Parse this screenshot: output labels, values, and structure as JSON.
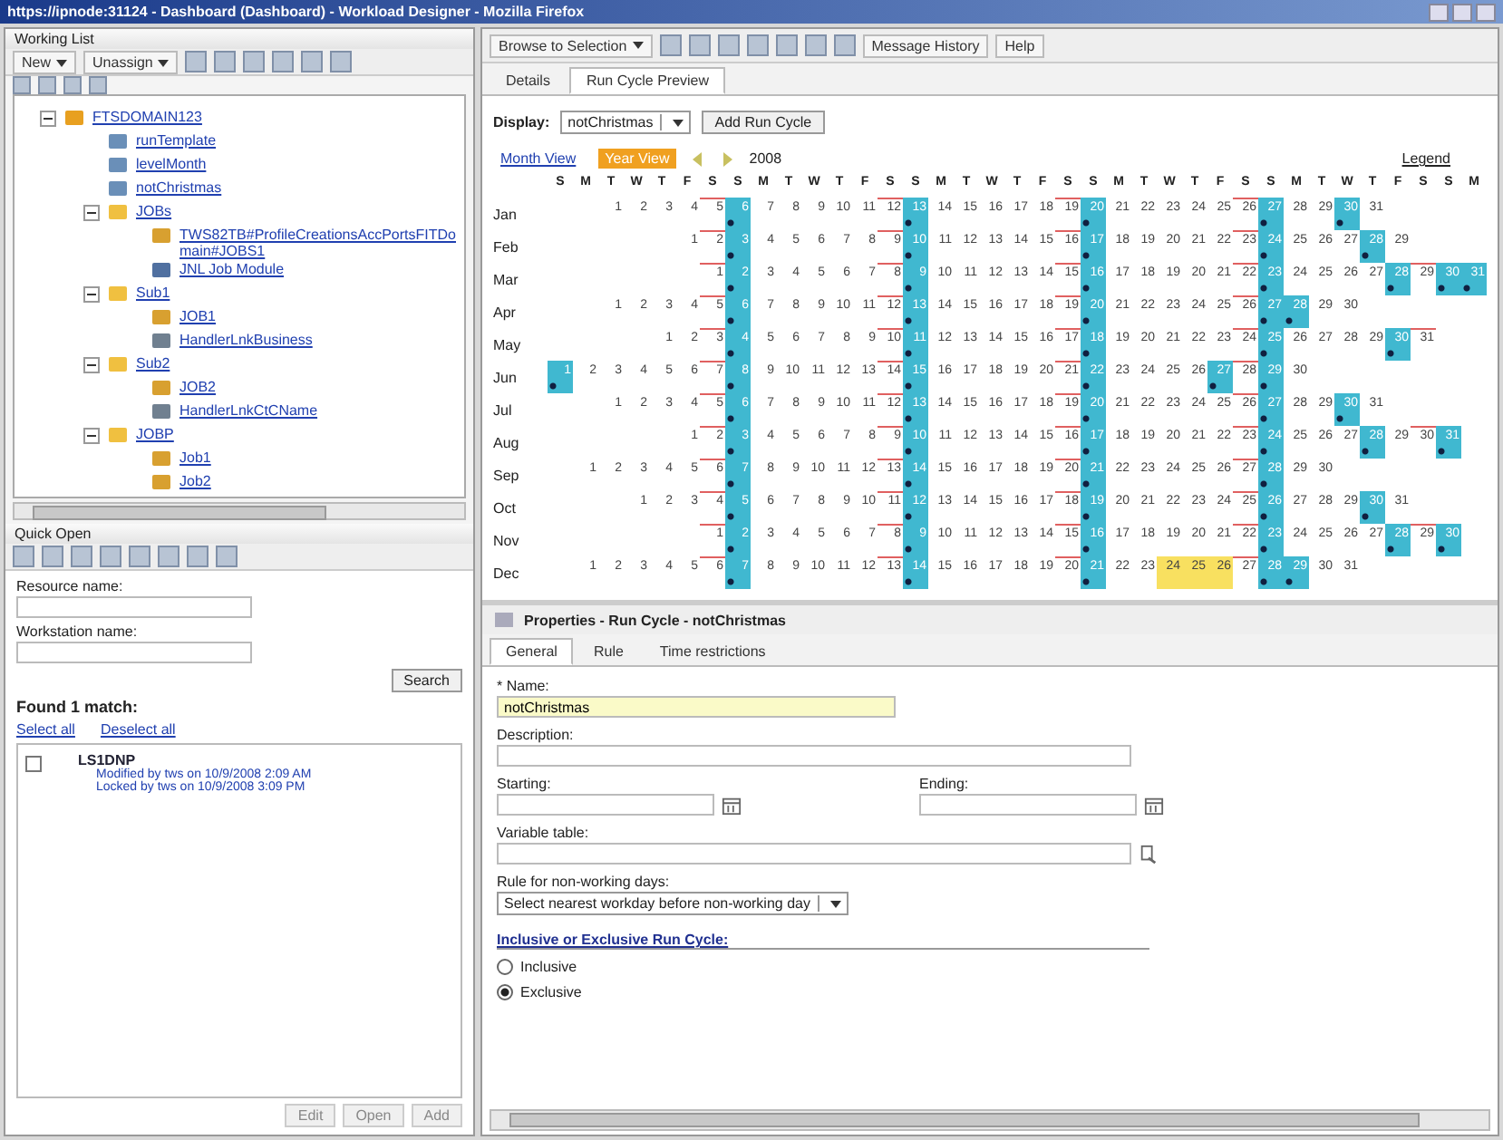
{
  "window": {
    "title": "https://ipnode:31124 - Dashboard (Dashboard) - Workload Designer - Mozilla Firefox"
  },
  "working_list": {
    "title": "Working List",
    "buttons": [
      "New",
      "Unassign"
    ],
    "tree": [
      {
        "label": "FTSDOMAIN123",
        "kind": "domain",
        "expanded": true,
        "children": [
          {
            "label": "runTemplate",
            "kind": "runcycle"
          },
          {
            "label": "levelMonth",
            "kind": "runcycle"
          },
          {
            "label": "notChristmas",
            "kind": "runcycle"
          },
          {
            "label": "JOBs",
            "kind": "folder",
            "expanded": true,
            "children": [
              {
                "label": "TWS82TB#ProfileCreationsAccPortsFITDomain#JOBS1",
                "kind": "job"
              },
              {
                "label": "JNL Job Module",
                "kind": "jobdef"
              }
            ]
          },
          {
            "label": "Sub1",
            "kind": "folder",
            "expanded": true,
            "children": [
              {
                "label": "JOB1",
                "kind": "job"
              },
              {
                "label": "HandlerLnkBusiness",
                "kind": "stream"
              }
            ]
          },
          {
            "label": "Sub2",
            "kind": "folder",
            "expanded": true,
            "children": [
              {
                "label": "JOB2",
                "kind": "job"
              },
              {
                "label": "HandlerLnkCtCName",
                "kind": "stream"
              }
            ]
          },
          {
            "label": "JOBP",
            "kind": "folder",
            "expanded": true,
            "children": [
              {
                "label": "Job1",
                "kind": "job"
              },
              {
                "label": "Job2",
                "kind": "job"
              }
            ]
          }
        ]
      }
    ]
  },
  "quick_open": {
    "title": "Quick Open",
    "fields": [
      {
        "label": "Resource name:"
      },
      {
        "label": "Workstation name:"
      }
    ],
    "search_button": "Search",
    "result_count": "Found 1 match:",
    "links": [
      "Select all",
      "Deselect all"
    ],
    "results": [
      {
        "name": "LS1DNP",
        "checked": false,
        "lines": [
          "Modified by tws on 10/9/2008 2:09 AM",
          "Locked by tws on 10/9/2008 3:09 PM"
        ]
      }
    ],
    "buttons": [
      "Edit",
      "Open",
      "Add"
    ]
  },
  "toolbar": {
    "browse": "Browse to Selection",
    "buttons": [
      "Message History",
      "Help"
    ]
  },
  "tabs": [
    {
      "label": "Details",
      "selected": false
    },
    {
      "label": "Run Cycle Preview",
      "selected": true
    }
  ],
  "display": {
    "label": "Display:",
    "value": "notChristmas",
    "add_button": "Add Run Cycle"
  },
  "views": [
    {
      "label": "Month View",
      "selected": false
    },
    {
      "label": "Year View",
      "selected": true
    }
  ],
  "year": "2008",
  "legend": "Legend",
  "calendar": {
    "weekdays": [
      "S",
      "M",
      "T",
      "W",
      "T",
      "F",
      "S",
      "S",
      "M",
      "T",
      "W",
      "T",
      "F",
      "S",
      "S",
      "M",
      "T",
      "W",
      "T",
      "F",
      "S",
      "S",
      "M",
      "T",
      "W",
      "T",
      "F",
      "S",
      "S",
      "M",
      "T",
      "W",
      "T",
      "F",
      "S",
      "S",
      "M"
    ],
    "months": [
      {
        "name": "Jan",
        "days": [
          {
            "day": "1",
            "run": false
          },
          {
            "day": "2",
            "run": false
          },
          {
            "day": "3",
            "run": false
          },
          {
            "day": "4",
            "run": false
          },
          {
            "day": "5",
            "run": false
          },
          {
            "day": "6",
            "run": true
          },
          {
            "day": "7",
            "run": false
          },
          {
            "day": "8",
            "run": false
          },
          {
            "day": "9",
            "run": false
          },
          {
            "day": "10",
            "run": false
          },
          {
            "day": "11",
            "run": false
          },
          {
            "day": "12",
            "run": false
          },
          {
            "day": "13",
            "run": true
          },
          {
            "day": "14",
            "run": false
          },
          {
            "day": "15",
            "run": false
          },
          {
            "day": "16",
            "run": false
          },
          {
            "day": "17",
            "run": false
          },
          {
            "day": "18",
            "run": false
          },
          {
            "day": "19",
            "run": false
          },
          {
            "day": "20",
            "run": true
          },
          {
            "day": "21",
            "run": false
          },
          {
            "day": "22",
            "run": false
          },
          {
            "day": "23",
            "run": false
          },
          {
            "day": "24",
            "run": false
          },
          {
            "day": "25",
            "run": false
          },
          {
            "day": "26",
            "run": false
          },
          {
            "day": "27",
            "run": true
          },
          {
            "day": "28",
            "run": false
          },
          {
            "day": "29",
            "run": false
          },
          {
            "day": "30",
            "run": true
          },
          {
            "day": "31",
            "run": false
          }
        ]
      },
      {
        "name": "Feb",
        "days": [
          {
            "day": "1",
            "run": false
          },
          {
            "day": "2",
            "run": false
          },
          {
            "day": "3",
            "run": true
          },
          {
            "day": "4",
            "run": false
          },
          {
            "day": "5",
            "run": false
          },
          {
            "day": "6",
            "run": false
          },
          {
            "day": "7",
            "run": false
          },
          {
            "day": "8",
            "run": false
          },
          {
            "day": "9",
            "run": false
          },
          {
            "day": "10",
            "run": true
          },
          {
            "day": "11",
            "run": false
          },
          {
            "day": "12",
            "run": false
          },
          {
            "day": "13",
            "run": false
          },
          {
            "day": "14",
            "run": false
          },
          {
            "day": "15",
            "run": false
          },
          {
            "day": "16",
            "run": false
          },
          {
            "day": "17",
            "run": true
          },
          {
            "day": "18",
            "run": false
          },
          {
            "day": "19",
            "run": false
          },
          {
            "day": "20",
            "run": false
          },
          {
            "day": "21",
            "run": false
          },
          {
            "day": "22",
            "run": false
          },
          {
            "day": "23",
            "run": false
          },
          {
            "day": "24",
            "run": true
          },
          {
            "day": "25",
            "run": false
          },
          {
            "day": "26",
            "run": false
          },
          {
            "day": "27",
            "run": false
          },
          {
            "day": "28",
            "run": true
          },
          {
            "day": "29",
            "run": false
          }
        ]
      },
      {
        "name": "Mar",
        "days": [
          {
            "day": "1",
            "run": false
          },
          {
            "day": "2",
            "run": true
          },
          {
            "day": "3",
            "run": false
          },
          {
            "day": "4",
            "run": false
          },
          {
            "day": "5",
            "run": false
          },
          {
            "day": "6",
            "run": false
          },
          {
            "day": "7",
            "run": false
          },
          {
            "day": "8",
            "run": false
          },
          {
            "day": "9",
            "run": true
          },
          {
            "day": "10",
            "run": false
          },
          {
            "day": "11",
            "run": false
          },
          {
            "day": "12",
            "run": false
          },
          {
            "day": "13",
            "run": false
          },
          {
            "day": "14",
            "run": false
          },
          {
            "day": "15",
            "run": false
          },
          {
            "day": "16",
            "run": true
          },
          {
            "day": "17",
            "run": false
          },
          {
            "day": "18",
            "run": false
          },
          {
            "day": "19",
            "run": false
          },
          {
            "day": "20",
            "run": false
          },
          {
            "day": "21",
            "run": false
          },
          {
            "day": "22",
            "run": false
          },
          {
            "day": "23",
            "run": true
          },
          {
            "day": "24",
            "run": false
          },
          {
            "day": "25",
            "run": false
          },
          {
            "day": "26",
            "run": false
          },
          {
            "day": "27",
            "run": false
          },
          {
            "day": "28",
            "run": true
          },
          {
            "day": "29",
            "run": false
          },
          {
            "day": "30",
            "run": true
          },
          {
            "day": "31",
            "run": true
          }
        ]
      },
      {
        "name": "Apr",
        "days": [
          {
            "day": "1",
            "run": false
          },
          {
            "day": "2",
            "run": false
          },
          {
            "day": "3",
            "run": false
          },
          {
            "day": "4",
            "run": false
          },
          {
            "day": "5",
            "run": false
          },
          {
            "day": "6",
            "run": true
          },
          {
            "day": "7",
            "run": false
          },
          {
            "day": "8",
            "run": false
          },
          {
            "day": "9",
            "run": false
          },
          {
            "day": "10",
            "run": false
          },
          {
            "day": "11",
            "run": false
          },
          {
            "day": "12",
            "run": false
          },
          {
            "day": "13",
            "run": true
          },
          {
            "day": "14",
            "run": false
          },
          {
            "day": "15",
            "run": false
          },
          {
            "day": "16",
            "run": false
          },
          {
            "day": "17",
            "run": false
          },
          {
            "day": "18",
            "run": false
          },
          {
            "day": "19",
            "run": false
          },
          {
            "day": "20",
            "run": true
          },
          {
            "day": "21",
            "run": false
          },
          {
            "day": "22",
            "run": false
          },
          {
            "day": "23",
            "run": false
          },
          {
            "day": "24",
            "run": false
          },
          {
            "day": "25",
            "run": false
          },
          {
            "day": "26",
            "run": false
          },
          {
            "day": "27",
            "run": true
          },
          {
            "day": "28",
            "run": true
          },
          {
            "day": "29",
            "run": false
          },
          {
            "day": "30",
            "run": false
          }
        ]
      },
      {
        "name": "May",
        "days": [
          {
            "day": "1",
            "run": false
          },
          {
            "day": "2",
            "run": false
          },
          {
            "day": "3",
            "run": false
          },
          {
            "day": "4",
            "run": true
          },
          {
            "day": "5",
            "run": false
          },
          {
            "day": "6",
            "run": false
          },
          {
            "day": "7",
            "run": false
          },
          {
            "day": "8",
            "run": false
          },
          {
            "day": "9",
            "run": false
          },
          {
            "day": "10",
            "run": false
          },
          {
            "day": "11",
            "run": true
          },
          {
            "day": "12",
            "run": false
          },
          {
            "day": "13",
            "run": false
          },
          {
            "day": "14",
            "run": false
          },
          {
            "day": "15",
            "run": false
          },
          {
            "day": "16",
            "run": false
          },
          {
            "day": "17",
            "run": false
          },
          {
            "day": "18",
            "run": true
          },
          {
            "day": "19",
            "run": false
          },
          {
            "day": "20",
            "run": false
          },
          {
            "day": "21",
            "run": false
          },
          {
            "day": "22",
            "run": false
          },
          {
            "day": "23",
            "run": false
          },
          {
            "day": "24",
            "run": false
          },
          {
            "day": "25",
            "run": true
          },
          {
            "day": "26",
            "run": false
          },
          {
            "day": "27",
            "run": false
          },
          {
            "day": "28",
            "run": false
          },
          {
            "day": "29",
            "run": false
          },
          {
            "day": "30",
            "run": true
          },
          {
            "day": "31",
            "run": false
          }
        ]
      },
      {
        "name": "Jun",
        "days": [
          {
            "day": "1",
            "run": true
          },
          {
            "day": "2",
            "run": false
          },
          {
            "day": "3",
            "run": false
          },
          {
            "day": "4",
            "run": false
          },
          {
            "day": "5",
            "run": false
          },
          {
            "day": "6",
            "run": false
          },
          {
            "day": "7",
            "run": false
          },
          {
            "day": "8",
            "run": true
          },
          {
            "day": "9",
            "run": false
          },
          {
            "day": "10",
            "run": false
          },
          {
            "day": "11",
            "run": false
          },
          {
            "day": "12",
            "run": false
          },
          {
            "day": "13",
            "run": false
          },
          {
            "day": "14",
            "run": false
          },
          {
            "day": "15",
            "run": true
          },
          {
            "day": "16",
            "run": false
          },
          {
            "day": "17",
            "run": false
          },
          {
            "day": "18",
            "run": false
          },
          {
            "day": "19",
            "run": false
          },
          {
            "day": "20",
            "run": false
          },
          {
            "day": "21",
            "run": false
          },
          {
            "day": "22",
            "run": true
          },
          {
            "day": "23",
            "run": false
          },
          {
            "day": "24",
            "run": false
          },
          {
            "day": "25",
            "run": false
          },
          {
            "day": "26",
            "run": false
          },
          {
            "day": "27",
            "run": true
          },
          {
            "day": "28",
            "run": false
          },
          {
            "day": "29",
            "run": true
          },
          {
            "day": "30",
            "run": false
          }
        ]
      },
      {
        "name": "Jul",
        "days": [
          {
            "day": "1",
            "run": false
          },
          {
            "day": "2",
            "run": false
          },
          {
            "day": "3",
            "run": false
          },
          {
            "day": "4",
            "run": false
          },
          {
            "day": "5",
            "run": false
          },
          {
            "day": "6",
            "run": true
          },
          {
            "day": "7",
            "run": false
          },
          {
            "day": "8",
            "run": false
          },
          {
            "day": "9",
            "run": false
          },
          {
            "day": "10",
            "run": false
          },
          {
            "day": "11",
            "run": false
          },
          {
            "day": "12",
            "run": false
          },
          {
            "day": "13",
            "run": true
          },
          {
            "day": "14",
            "run": false
          },
          {
            "day": "15",
            "run": false
          },
          {
            "day": "16",
            "run": false
          },
          {
            "day": "17",
            "run": false
          },
          {
            "day": "18",
            "run": false
          },
          {
            "day": "19",
            "run": false
          },
          {
            "day": "20",
            "run": true
          },
          {
            "day": "21",
            "run": false
          },
          {
            "day": "22",
            "run": false
          },
          {
            "day": "23",
            "run": false
          },
          {
            "day": "24",
            "run": false
          },
          {
            "day": "25",
            "run": false
          },
          {
            "day": "26",
            "run": false
          },
          {
            "day": "27",
            "run": true
          },
          {
            "day": "28",
            "run": false
          },
          {
            "day": "29",
            "run": false
          },
          {
            "day": "30",
            "run": true
          },
          {
            "day": "31",
            "run": false
          }
        ]
      },
      {
        "name": "Aug",
        "days": [
          {
            "day": "1",
            "run": false
          },
          {
            "day": "2",
            "run": false
          },
          {
            "day": "3",
            "run": true
          },
          {
            "day": "4",
            "run": false
          },
          {
            "day": "5",
            "run": false
          },
          {
            "day": "6",
            "run": false
          },
          {
            "day": "7",
            "run": false
          },
          {
            "day": "8",
            "run": false
          },
          {
            "day": "9",
            "run": false
          },
          {
            "day": "10",
            "run": true
          },
          {
            "day": "11",
            "run": false
          },
          {
            "day": "12",
            "run": false
          },
          {
            "day": "13",
            "run": false
          },
          {
            "day": "14",
            "run": false
          },
          {
            "day": "15",
            "run": false
          },
          {
            "day": "16",
            "run": false
          },
          {
            "day": "17",
            "run": true
          },
          {
            "day": "18",
            "run": false
          },
          {
            "day": "19",
            "run": false
          },
          {
            "day": "20",
            "run": false
          },
          {
            "day": "21",
            "run": false
          },
          {
            "day": "22",
            "run": false
          },
          {
            "day": "23",
            "run": false
          },
          {
            "day": "24",
            "run": true
          },
          {
            "day": "25",
            "run": false
          },
          {
            "day": "26",
            "run": false
          },
          {
            "day": "27",
            "run": false
          },
          {
            "day": "28",
            "run": true
          },
          {
            "day": "29",
            "run": false
          },
          {
            "day": "30",
            "run": false
          },
          {
            "day": "31",
            "run": true
          }
        ]
      },
      {
        "name": "Sep",
        "days": [
          {
            "day": "1",
            "run": false
          },
          {
            "day": "2",
            "run": false
          },
          {
            "day": "3",
            "run": false
          },
          {
            "day": "4",
            "run": false
          },
          {
            "day": "5",
            "run": false
          },
          {
            "day": "6",
            "run": false
          },
          {
            "day": "7",
            "run": true
          },
          {
            "day": "8",
            "run": false
          },
          {
            "day": "9",
            "run": false
          },
          {
            "day": "10",
            "run": false
          },
          {
            "day": "11",
            "run": false
          },
          {
            "day": "12",
            "run": false
          },
          {
            "day": "13",
            "run": false
          },
          {
            "day": "14",
            "run": true
          },
          {
            "day": "15",
            "run": false
          },
          {
            "day": "16",
            "run": false
          },
          {
            "day": "17",
            "run": false
          },
          {
            "day": "18",
            "run": false
          },
          {
            "day": "19",
            "run": false
          },
          {
            "day": "20",
            "run": false
          },
          {
            "day": "21",
            "run": true
          },
          {
            "day": "22",
            "run": false
          },
          {
            "day": "23",
            "run": false
          },
          {
            "day": "24",
            "run": false
          },
          {
            "day": "25",
            "run": false
          },
          {
            "day": "26",
            "run": false
          },
          {
            "day": "27",
            "run": false
          },
          {
            "day": "28",
            "run": true
          },
          {
            "day": "29",
            "run": false
          },
          {
            "day": "30",
            "run": false
          }
        ]
      },
      {
        "name": "Oct",
        "days": [
          {
            "day": "1",
            "run": false
          },
          {
            "day": "2",
            "run": false
          },
          {
            "day": "3",
            "run": false
          },
          {
            "day": "4",
            "run": false
          },
          {
            "day": "5",
            "run": true
          },
          {
            "day": "6",
            "run": false
          },
          {
            "day": "7",
            "run": false
          },
          {
            "day": "8",
            "run": false
          },
          {
            "day": "9",
            "run": false
          },
          {
            "day": "10",
            "run": false
          },
          {
            "day": "11",
            "run": false
          },
          {
            "day": "12",
            "run": true
          },
          {
            "day": "13",
            "run": false
          },
          {
            "day": "14",
            "run": false
          },
          {
            "day": "15",
            "run": false
          },
          {
            "day": "16",
            "run": false
          },
          {
            "day": "17",
            "run": false
          },
          {
            "day": "18",
            "run": false
          },
          {
            "day": "19",
            "run": true
          },
          {
            "day": "20",
            "run": false
          },
          {
            "day": "21",
            "run": false
          },
          {
            "day": "22",
            "run": false
          },
          {
            "day": "23",
            "run": false
          },
          {
            "day": "24",
            "run": false
          },
          {
            "day": "25",
            "run": false
          },
          {
            "day": "26",
            "run": true
          },
          {
            "day": "27",
            "run": false
          },
          {
            "day": "28",
            "run": false
          },
          {
            "day": "29",
            "run": false
          },
          {
            "day": "30",
            "run": true
          },
          {
            "day": "31",
            "run": false
          }
        ]
      },
      {
        "name": "Nov",
        "days": [
          {
            "day": "1",
            "run": false
          },
          {
            "day": "2",
            "run": true
          },
          {
            "day": "3",
            "run": false
          },
          {
            "day": "4",
            "run": false
          },
          {
            "day": "5",
            "run": false
          },
          {
            "day": "6",
            "run": false
          },
          {
            "day": "7",
            "run": false
          },
          {
            "day": "8",
            "run": false
          },
          {
            "day": "9",
            "run": true
          },
          {
            "day": "10",
            "run": false
          },
          {
            "day": "11",
            "run": false
          },
          {
            "day": "12",
            "run": false
          },
          {
            "day": "13",
            "run": false
          },
          {
            "day": "14",
            "run": false
          },
          {
            "day": "15",
            "run": false
          },
          {
            "day": "16",
            "run": true
          },
          {
            "day": "17",
            "run": false
          },
          {
            "day": "18",
            "run": false
          },
          {
            "day": "19",
            "run": false
          },
          {
            "day": "20",
            "run": false
          },
          {
            "day": "21",
            "run": false
          },
          {
            "day": "22",
            "run": false
          },
          {
            "day": "23",
            "run": true
          },
          {
            "day": "24",
            "run": false
          },
          {
            "day": "25",
            "run": false
          },
          {
            "day": "26",
            "run": false
          },
          {
            "day": "27",
            "run": false
          },
          {
            "day": "28",
            "run": true
          },
          {
            "day": "29",
            "run": false
          },
          {
            "day": "30",
            "run": true
          }
        ]
      },
      {
        "name": "Dec",
        "days": [
          {
            "day": "1",
            "run": false,
            "closed": false
          },
          {
            "day": "2",
            "run": false,
            "closed": false
          },
          {
            "day": "3",
            "run": false,
            "closed": false
          },
          {
            "day": "4",
            "run": false,
            "closed": false
          },
          {
            "day": "5",
            "run": false,
            "closed": false
          },
          {
            "day": "6",
            "run": false,
            "closed": false
          },
          {
            "day": "7",
            "run": true,
            "closed": false
          },
          {
            "day": "8",
            "run": false,
            "closed": false
          },
          {
            "day": "9",
            "run": false,
            "closed": false
          },
          {
            "day": "10",
            "run": false,
            "closed": false
          },
          {
            "day": "11",
            "run": false,
            "closed": false
          },
          {
            "day": "12",
            "run": false,
            "closed": false
          },
          {
            "day": "13",
            "run": false,
            "closed": false
          },
          {
            "day": "14",
            "run": true,
            "closed": false
          },
          {
            "day": "15",
            "run": false,
            "closed": false
          },
          {
            "day": "16",
            "run": false,
            "closed": false
          },
          {
            "day": "17",
            "run": false,
            "closed": false
          },
          {
            "day": "18",
            "run": false,
            "closed": false
          },
          {
            "day": "19",
            "run": false,
            "closed": false
          },
          {
            "day": "20",
            "run": false,
            "closed": false
          },
          {
            "day": "21",
            "run": true,
            "closed": false
          },
          {
            "day": "22",
            "run": false,
            "closed": false
          },
          {
            "day": "23",
            "run": false,
            "closed": false
          },
          {
            "day": "24",
            "run": false,
            "closed": true
          },
          {
            "day": "25",
            "run": false,
            "closed": true
          },
          {
            "day": "26",
            "run": false,
            "closed": true
          },
          {
            "day": "27",
            "run": false,
            "closed": false
          },
          {
            "day": "28",
            "run": true,
            "closed": false
          },
          {
            "day": "29",
            "run": true,
            "closed": false
          },
          {
            "day": "30",
            "run": false,
            "closed": false
          },
          {
            "day": "31",
            "run": false,
            "closed": false
          }
        ]
      }
    ]
  },
  "properties": {
    "title": "Properties - Run Cycle - notChristmas",
    "tabs": [
      {
        "label": "General",
        "selected": true
      },
      {
        "label": "Rule",
        "selected": false
      },
      {
        "label": "Time restrictions",
        "selected": false
      }
    ],
    "name": {
      "label": "* Name:",
      "value": "notChristmas"
    },
    "description": {
      "label": "Description:"
    },
    "starting": {
      "label": "Starting:"
    },
    "ending": {
      "label": "Ending:"
    },
    "variable_table": {
      "label": "Variable table:"
    },
    "non_working_rule": {
      "label": "Rule for non-working days:",
      "value": "Select nearest workday before non-working day"
    },
    "inclusion": {
      "heading": "Inclusive or Exclusive Run Cycle:",
      "options": [
        {
          "label": "Inclusive",
          "selected": false
        },
        {
          "label": "Exclusive",
          "selected": true
        }
      ]
    }
  }
}
